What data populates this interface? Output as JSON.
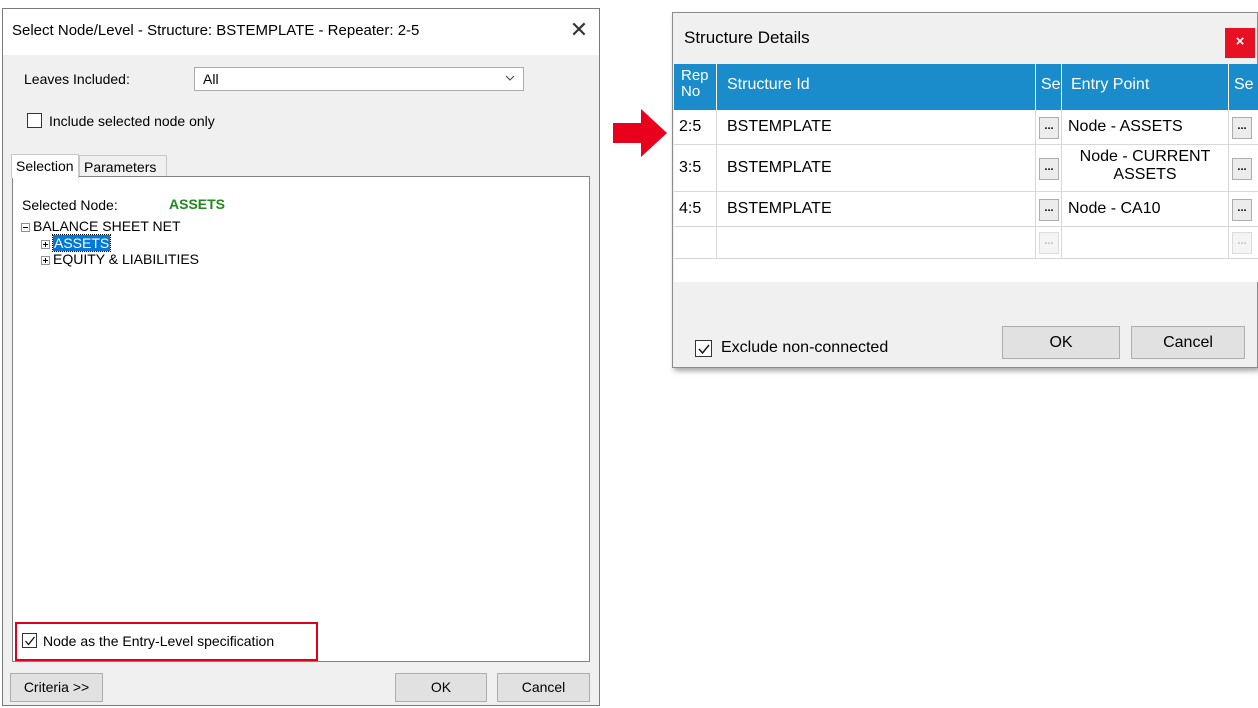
{
  "left_dialog": {
    "title": "Select Node/Level - Structure: BSTEMPLATE - Repeater: 2-5",
    "close_glyph": "✕",
    "leaves_label": "Leaves Included:",
    "leaves_value": "All",
    "include_selected_label": "Include selected node only",
    "include_selected_checked": false,
    "tabs": [
      "Selection",
      "Parameters"
    ],
    "active_tab": "Selection",
    "selected_node_label": "Selected Node:",
    "selected_node_value": "ASSETS",
    "selected_node_color": "#1e8a1e",
    "tree": [
      {
        "label": "BALANCE SHEET NET",
        "expanded": true
      },
      {
        "label": "ASSETS",
        "expanded": false,
        "selected": true
      },
      {
        "label": "EQUITY & LIABILITIES",
        "expanded": false
      }
    ],
    "entry_level_label": "Node as the Entry-Level specification",
    "entry_level_checked": true,
    "highlight_color": "#e0001a",
    "criteria_button": "Criteria >>",
    "ok_button": "OK",
    "cancel_button": "Cancel"
  },
  "arrow": {
    "color": "#e8001c",
    "icon": "right-arrow-icon"
  },
  "right_dialog": {
    "title": "Structure Details",
    "close_glyph": "×",
    "columns": [
      "Rep No",
      "Structure Id",
      "Se",
      "Entry Point",
      "Se"
    ],
    "header_color": "#1a8ccc",
    "rows": [
      {
        "rep_no": "2:5",
        "structure_id": "BSTEMPLATE",
        "entry_point": "Node - ASSETS"
      },
      {
        "rep_no": "3:5",
        "structure_id": "BSTEMPLATE",
        "entry_point": "Node - CURRENT ASSETS"
      },
      {
        "rep_no": "4:5",
        "structure_id": "BSTEMPLATE",
        "entry_point": "Node - CA10"
      }
    ],
    "ellipsis": "...",
    "exclude_label": "Exclude non-connected",
    "exclude_checked": true,
    "ok_button": "OK",
    "cancel_button": "Cancel"
  }
}
